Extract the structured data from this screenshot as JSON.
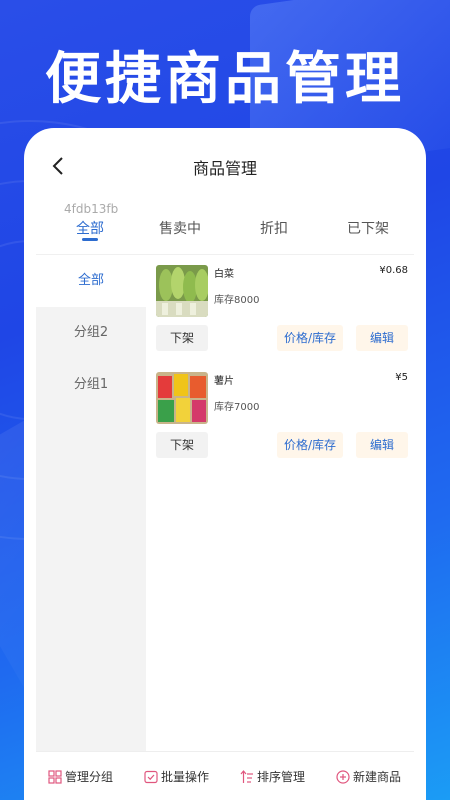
{
  "headline": "便捷商品管理",
  "navbar": {
    "title": "商品管理"
  },
  "tabs": [
    {
      "sub": "4fdb13fb",
      "label": "全部",
      "active": true
    },
    {
      "label": "售卖中"
    },
    {
      "label": "折扣"
    },
    {
      "label": "已下架"
    }
  ],
  "sidebar": {
    "items": [
      "全部",
      "分组2",
      "分组1"
    ]
  },
  "goods": [
    {
      "name": "白菜",
      "price": "¥0.68",
      "stock": "库存8000",
      "off_label": "下架",
      "price_label": "价格/库存",
      "edit_label": "编辑"
    },
    {
      "name": "薯片",
      "price": "¥5",
      "stock": "库存7000",
      "off_label": "下架",
      "price_label": "价格/库存",
      "edit_label": "编辑"
    }
  ],
  "bottom_bar": {
    "manage_group": "管理分组",
    "batch": "批量操作",
    "sort": "排序管理",
    "new_item": "新建商品"
  },
  "colors": {
    "accent": "#2d6ccf",
    "icon": "#e0567e",
    "bg_blue": "#1f46e6"
  }
}
